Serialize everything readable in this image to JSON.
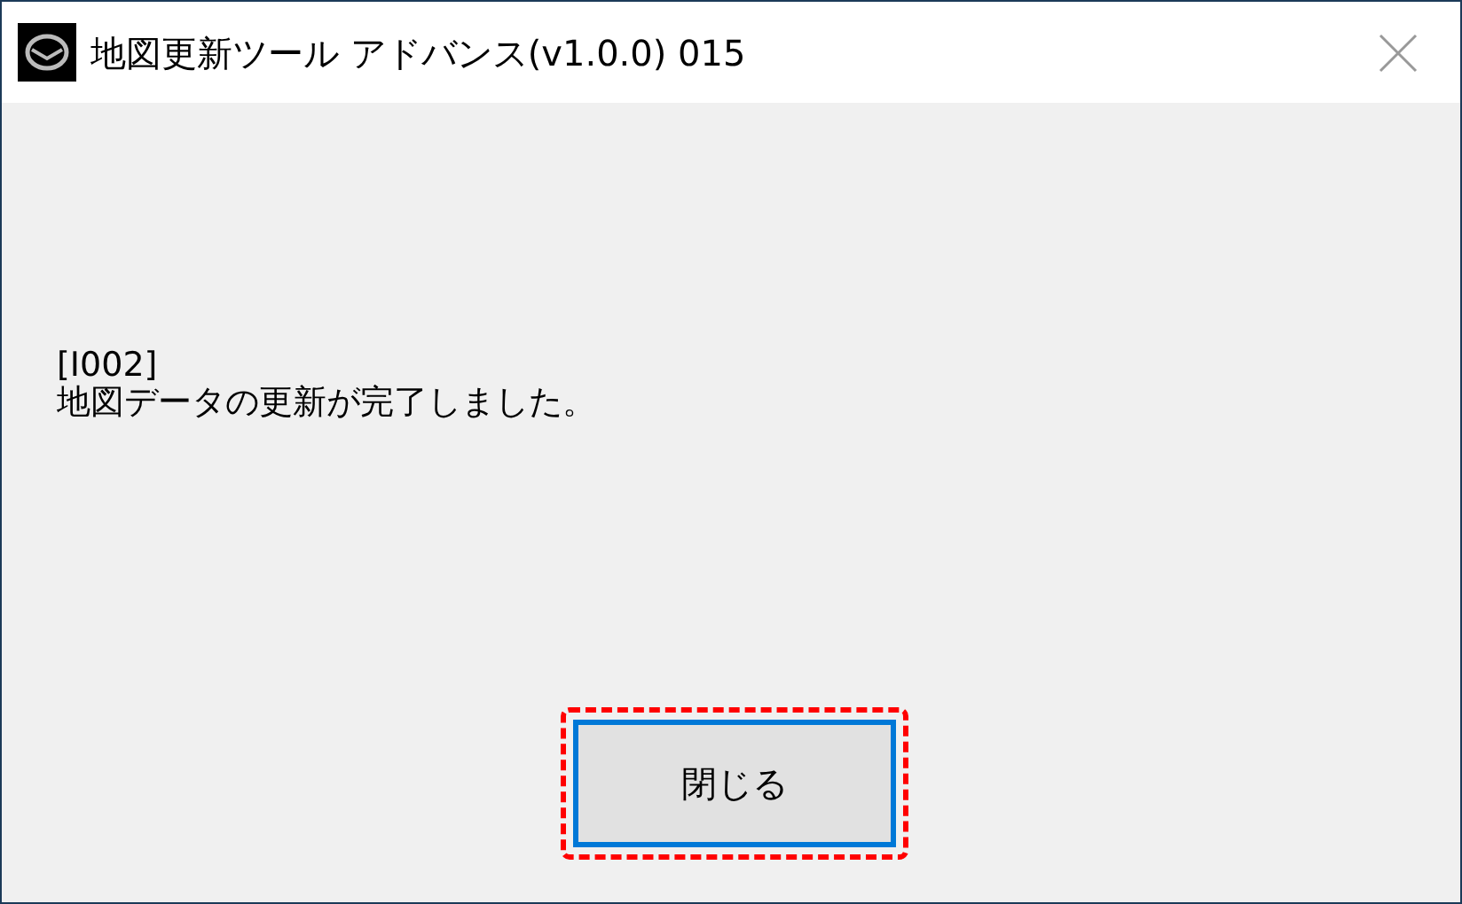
{
  "window": {
    "title": "地図更新ツール アドバンス(v1.0.0) 015"
  },
  "message": {
    "code": "[I002]",
    "text": "地図データの更新が完了しました。"
  },
  "button": {
    "label": "閉じる",
    "focused": true,
    "highlighted": true
  }
}
